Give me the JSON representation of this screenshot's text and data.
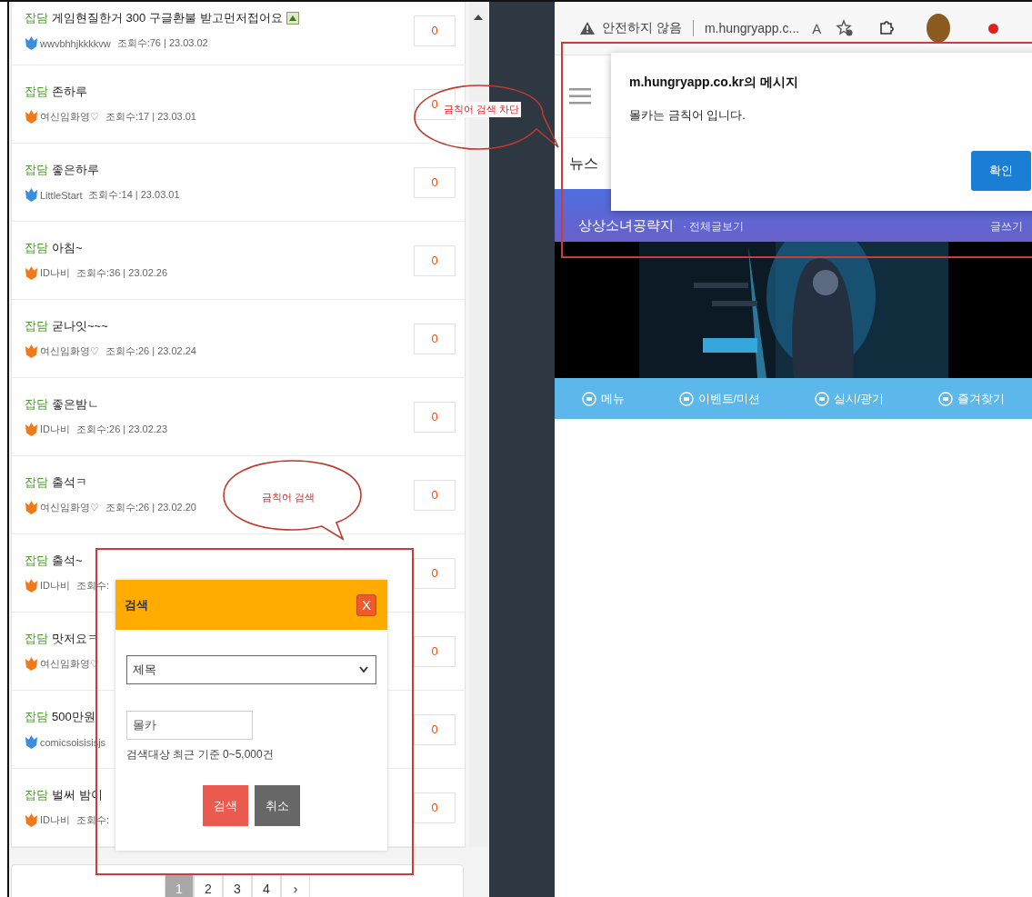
{
  "posts": [
    {
      "category": "잡담",
      "title": "게임현질한거 300 구글환불 받고먼저접어요",
      "has_image": true,
      "user": "wwvbhhjkkkkvw",
      "color": "#3a8ee0",
      "meta": "조회수:76 | 23.03.02",
      "count": "0"
    },
    {
      "category": "잡담",
      "title": "존하루",
      "has_image": false,
      "user": "여신임화영♡",
      "color": "#f07a1a",
      "meta": "조회수:17 | 23.03.01",
      "count": "0"
    },
    {
      "category": "잡담",
      "title": "좋은하루",
      "has_image": false,
      "user": "LittleStart",
      "color": "#3a8ee0",
      "meta": "조회수:14 | 23.03.01",
      "count": "0"
    },
    {
      "category": "잡담",
      "title": "아침~",
      "has_image": false,
      "user": "ID나비",
      "color": "#f07a1a",
      "meta": "조회수:36 | 23.02.26",
      "count": "0"
    },
    {
      "category": "잡담",
      "title": "굳나잇~~~",
      "has_image": false,
      "user": "여신임화영♡",
      "color": "#f07a1a",
      "meta": "조회수:26 | 23.02.24",
      "count": "0"
    },
    {
      "category": "잡담",
      "title": "좋은밤ㄴ",
      "has_image": false,
      "user": "ID나비",
      "color": "#f07a1a",
      "meta": "조회수:26 | 23.02.23",
      "count": "0"
    },
    {
      "category": "잡담",
      "title": "출석ㅋ",
      "has_image": false,
      "user": "여신임화영♡",
      "color": "#f07a1a",
      "meta": "조회수:26 | 23.02.20",
      "count": "0"
    },
    {
      "category": "잡담",
      "title": "출석~",
      "has_image": false,
      "user": "ID나비",
      "color": "#f07a1a",
      "meta": "조회수:",
      "count": "0"
    },
    {
      "category": "잡담",
      "title": "맛저요ㅋ",
      "has_image": false,
      "user": "여신임화영♡",
      "color": "#f07a1a",
      "count": "0"
    },
    {
      "category": "잡담",
      "title": "500만원",
      "has_image": false,
      "user": "comicsoisisisjs",
      "color": "#3a8ee0",
      "count": "0"
    },
    {
      "category": "잡담",
      "title": "벌써 밤이",
      "has_image": false,
      "user": "ID나비",
      "color": "#f07a1a",
      "meta": "조회수:",
      "count": "0"
    }
  ],
  "pagination": [
    {
      "label": "1",
      "selected": true
    },
    {
      "label": "2",
      "selected": false
    },
    {
      "label": "3",
      "selected": false
    },
    {
      "label": "4",
      "selected": false
    },
    {
      "label": "›",
      "selected": false
    }
  ],
  "search_dialog": {
    "title": "검색",
    "close": "X",
    "field": "제목",
    "query": "몰카",
    "hint": "검색대상 최근 기준 0~5,000건",
    "buttons": [
      "검색",
      "취소"
    ]
  },
  "browser": {
    "security": "안전하지 않음",
    "url": "m.hungryapp.c...",
    "read_aloud": "A"
  },
  "site": {
    "tab": "뉴스",
    "board_title": "상상소녀공략지",
    "board_link": "· 전체글보기",
    "write": "글쓰기",
    "nav": [
      "메뉴",
      "이벤트/미션",
      "실시/광기",
      "즐겨찾기"
    ]
  },
  "alert": {
    "title": "m.hungryapp.co.kr의 메시지",
    "message": "몰카는 금칙어 입니다.",
    "button": "확인"
  },
  "annotations": [
    {
      "text": "금칙어 검색 차단"
    },
    {
      "text": "금칙어 검색"
    }
  ]
}
